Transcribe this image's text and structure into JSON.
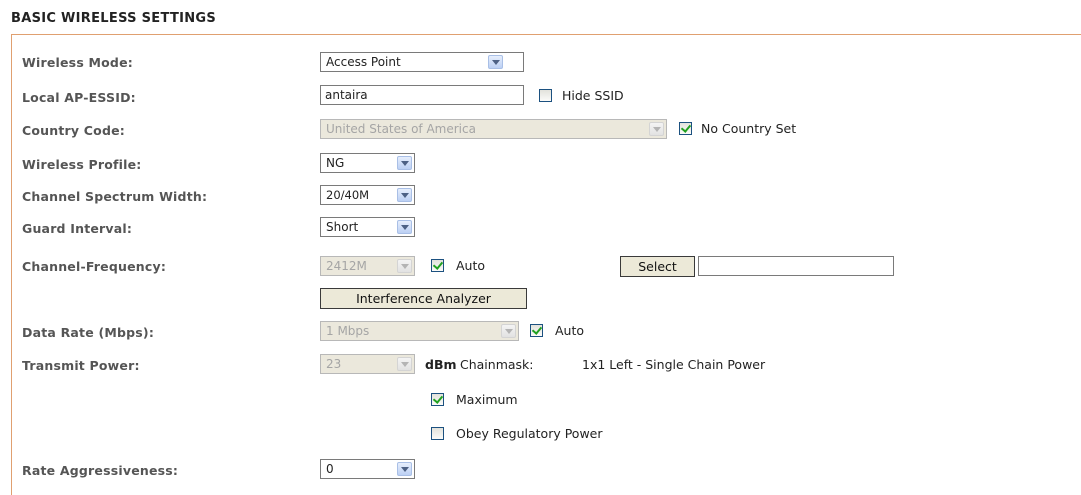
{
  "section_title": "BASIC WIRELESS SETTINGS",
  "rows": {
    "wireless_mode": {
      "label": "Wireless Mode:",
      "value": "Access Point"
    },
    "local_ap_essid": {
      "label": "Local AP-ESSID:",
      "value": "antaira",
      "hide_ssid_label": "Hide SSID",
      "hide_ssid_checked": false
    },
    "country_code": {
      "label": "Country Code:",
      "value": "United States of America",
      "no_country_label": "No Country Set",
      "no_country_checked": true
    },
    "wireless_profile": {
      "label": "Wireless Profile:",
      "value": "NG"
    },
    "channel_spectrum_width": {
      "label": "Channel Spectrum Width:",
      "value": "20/40M"
    },
    "guard_interval": {
      "label": "Guard Interval:",
      "value": "Short"
    },
    "channel_frequency": {
      "label": "Channel-Frequency:",
      "value": "2412M",
      "auto_label": "Auto",
      "auto_checked": true,
      "select_button": "Select",
      "select_value": "",
      "analyzer_button": "Interference Analyzer"
    },
    "data_rate": {
      "label": "Data Rate (Mbps):",
      "value": "1 Mbps",
      "auto_label": "Auto",
      "auto_checked": true
    },
    "transmit_power": {
      "label": "Transmit Power:",
      "value": "23",
      "unit": "dBm",
      "chainmask_label": "Chainmask:",
      "chainmask_value": "1x1 Left - Single Chain Power",
      "maximum_label": "Maximum",
      "maximum_checked": true,
      "obey_label": "Obey Regulatory Power",
      "obey_checked": false
    },
    "rate_aggressiveness": {
      "label": "Rate Aggressiveness:",
      "value": "0"
    }
  },
  "icons": {
    "dropdown": "chevron-down-icon",
    "checkbox_checked": "checkmark-icon"
  },
  "colors": {
    "panel_border": "#e0a070",
    "check_green": "#21a121",
    "disabled_bg": "#ebe8dc"
  }
}
